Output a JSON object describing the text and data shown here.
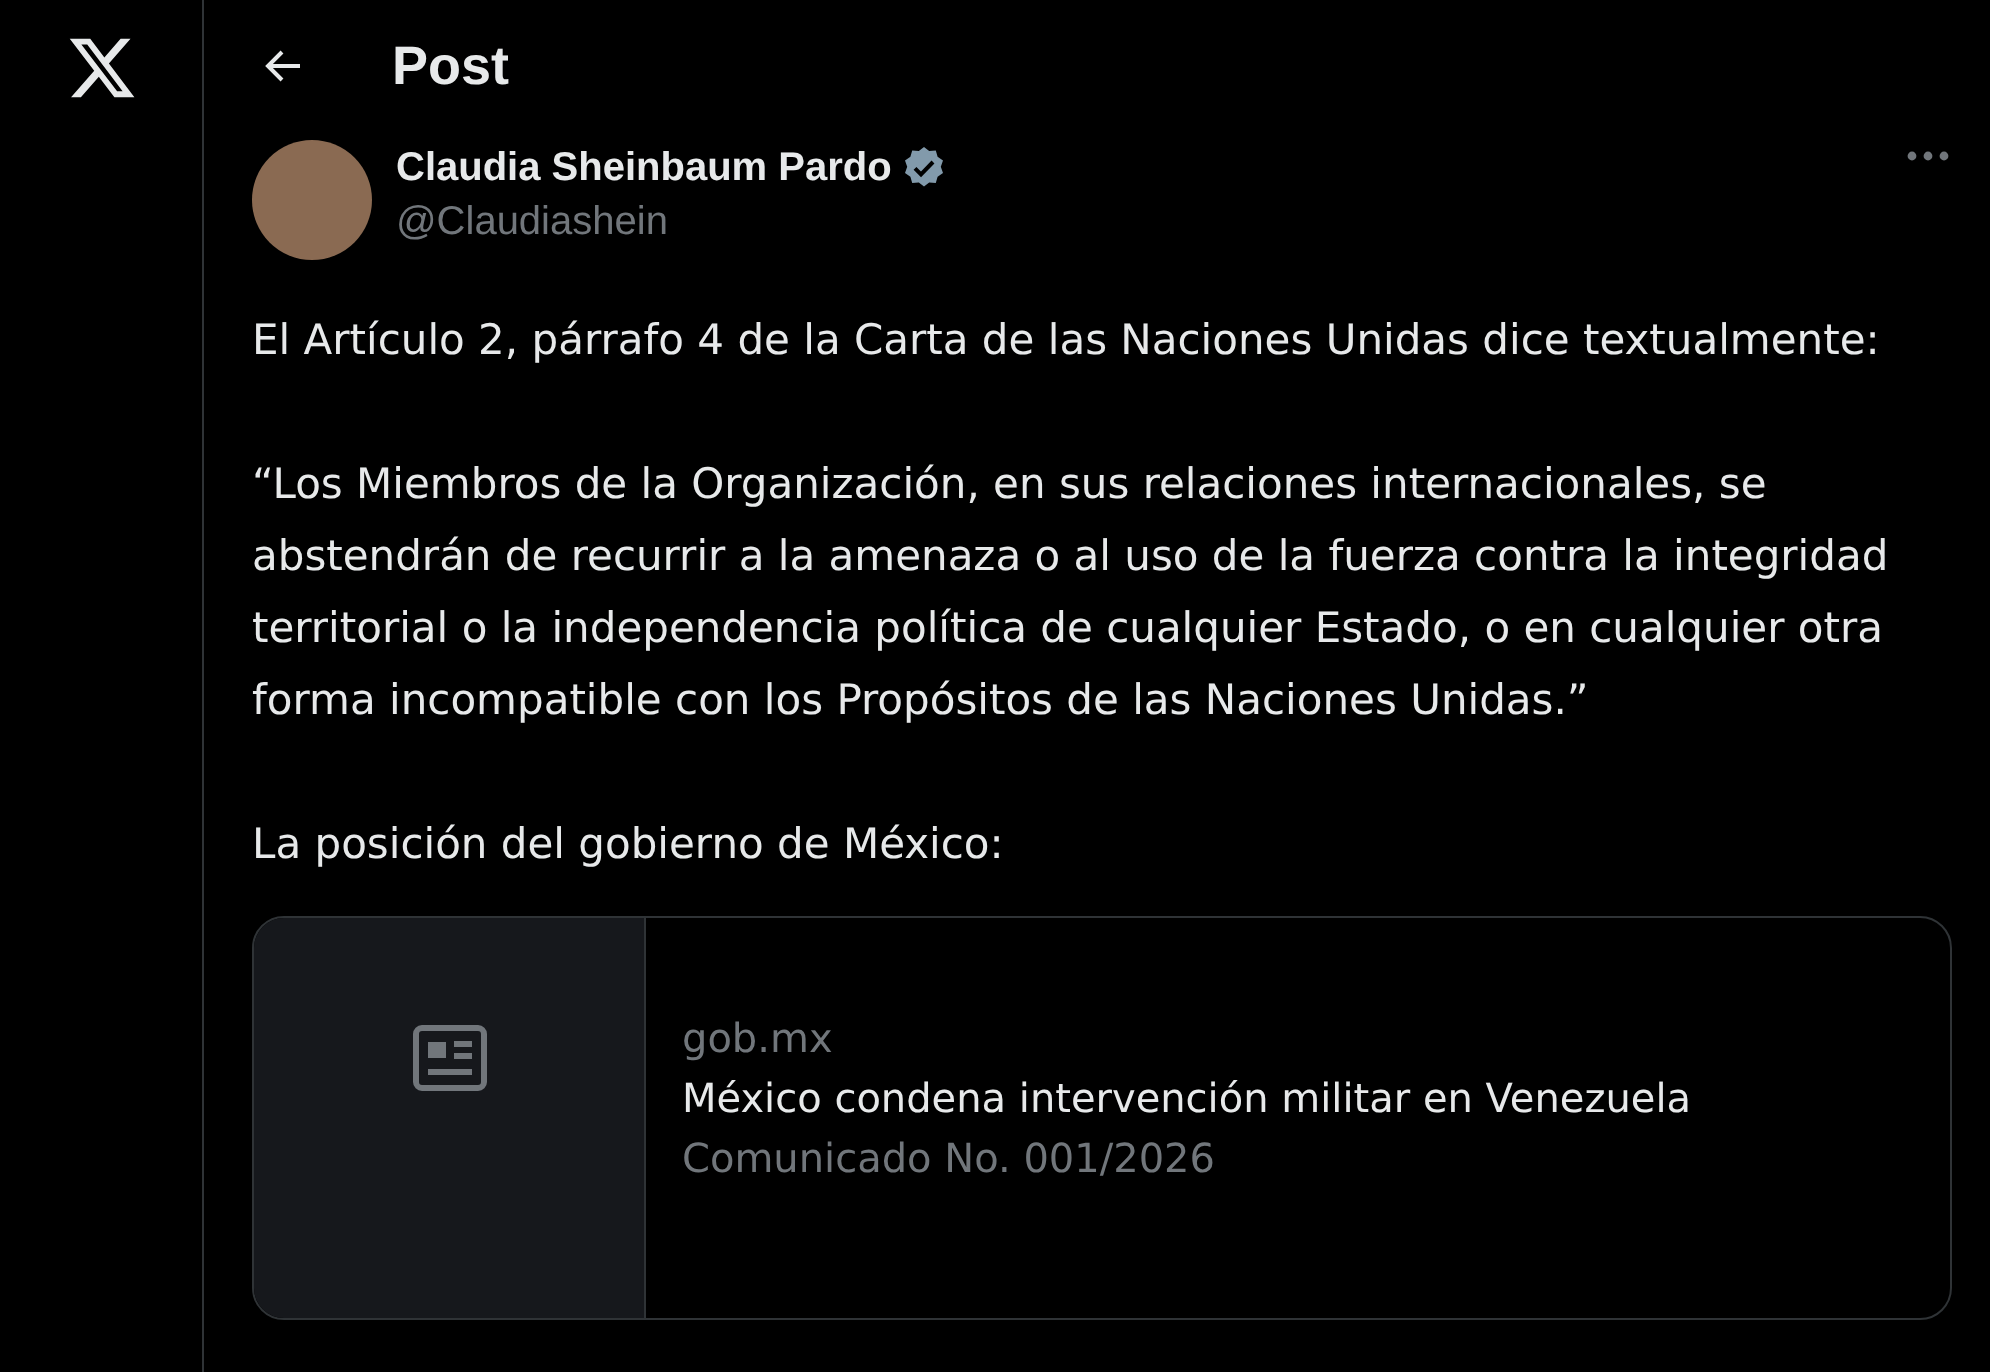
{
  "header": {
    "title": "Post"
  },
  "post": {
    "author": {
      "name": "Claudia Sheinbaum Pardo",
      "handle": "@Claudiashein",
      "verified": true
    },
    "paragraphs": [
      "El Artículo 2, párrafo 4 de la Carta de las Naciones Unidas dice textualmente:",
      "“Los Miembros de la Organización, en sus relaciones internacionales, se abstendrán de recurrir a la amenaza o al uso de la fuerza contra la integridad territorial o la independencia política de cualquier Estado, o en cualquier otra forma incompatible con los Propósitos de las Naciones Unidas.”",
      "La posición del gobierno de México:"
    ],
    "link_card": {
      "domain": "gob.mx",
      "title": "México condena intervención militar en Venezuela",
      "description": "Comunicado No. 001/2026"
    }
  }
}
